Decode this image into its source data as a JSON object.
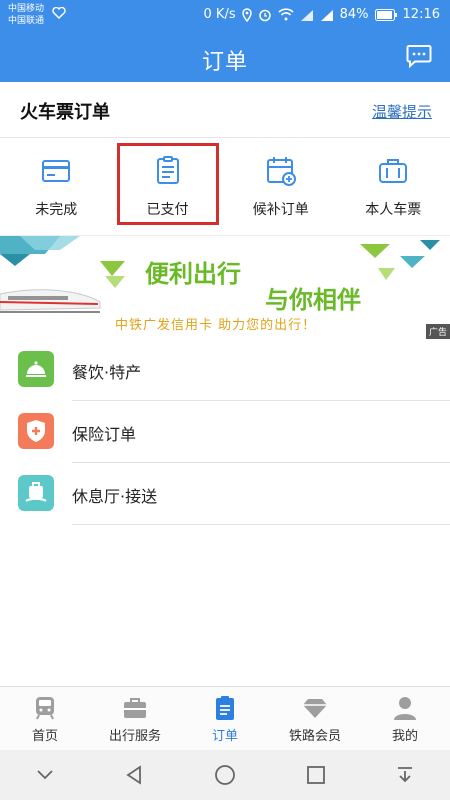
{
  "statusbar": {
    "carrier1": "中国移动",
    "carrier2": "中国联通",
    "speed": "0 K/s",
    "battery": "84%",
    "time": "12:16"
  },
  "header": {
    "title": "订单"
  },
  "section": {
    "title": "火车票订单",
    "tip": "温馨提示"
  },
  "categories": [
    {
      "label": "未完成",
      "icon": "card-icon"
    },
    {
      "label": "已支付",
      "icon": "receipt-icon"
    },
    {
      "label": "候补订单",
      "icon": "calendar-add-icon"
    },
    {
      "label": "本人车票",
      "icon": "luggage-icon"
    }
  ],
  "banner": {
    "line1": "便利出行",
    "line2": "与你相伴",
    "line3": "中铁广发信用卡  助力您的出行！",
    "ad": "广告"
  },
  "list": [
    {
      "label": "餐饮·特产",
      "icon": "dining-icon",
      "color": "#6ac04b"
    },
    {
      "label": "保险订单",
      "icon": "shield-icon",
      "color": "#f47b5a"
    },
    {
      "label": "休息厅·接送",
      "icon": "lounge-icon",
      "color": "#5cc9c8"
    }
  ],
  "bottomnav": [
    {
      "label": "首页",
      "icon": "train-icon"
    },
    {
      "label": "出行服务",
      "icon": "briefcase-icon"
    },
    {
      "label": "订单",
      "icon": "order-icon",
      "active": true
    },
    {
      "label": "铁路会员",
      "icon": "diamond-icon"
    },
    {
      "label": "我的",
      "icon": "person-icon"
    }
  ],
  "colors": {
    "primary": "#3d8ee8",
    "link": "#2d6fbf",
    "banner_green": "#6aba28",
    "banner_orange": "#e3a318",
    "highlight": "#d32f2f"
  }
}
